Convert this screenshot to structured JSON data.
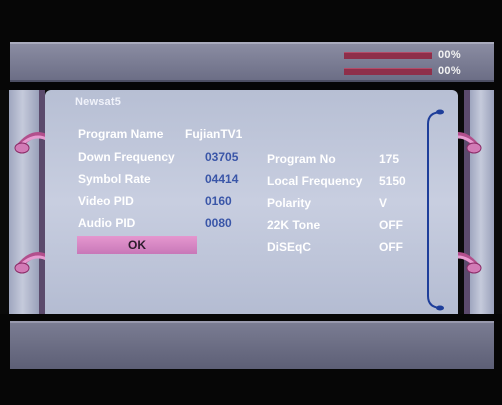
{
  "signal": {
    "strength_percent": "00%",
    "quality_percent": "00%",
    "strength_value": 0,
    "quality_value": 0
  },
  "satellite": {
    "name": "Newsat5"
  },
  "left_fields": [
    {
      "label": "Program Name",
      "value": "FujianTV1"
    },
    {
      "label": "Down Frequency",
      "value": "03705"
    },
    {
      "label": "Symbol Rate",
      "value": "04414"
    },
    {
      "label": "Video PID",
      "value": "0160"
    },
    {
      "label": "Audio PID",
      "value": "0080"
    }
  ],
  "right_fields": [
    {
      "label": "Program No",
      "value": "175"
    },
    {
      "label": "Local Frequency",
      "value": "5150"
    },
    {
      "label": "Polarity",
      "value": "V"
    },
    {
      "label": "22K Tone",
      "value": "OFF"
    },
    {
      "label": "DiSEqC",
      "value": "OFF"
    }
  ],
  "ok_button": {
    "label": "OK"
  },
  "colors": {
    "accent": "#e597cf",
    "value_blue": "#3a56a8",
    "bar": "#8e2f4a"
  }
}
